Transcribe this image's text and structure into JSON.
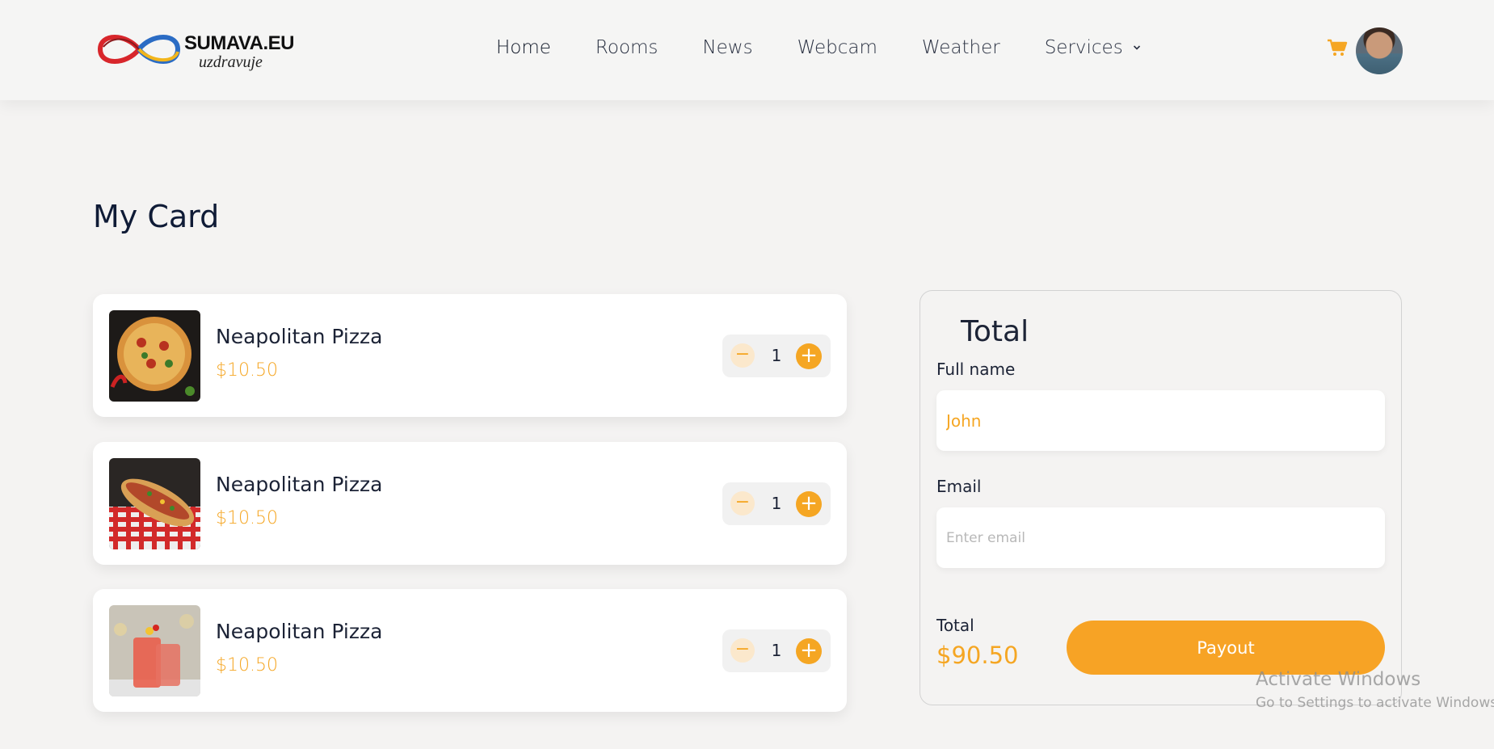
{
  "header": {
    "logo_text": "SUMAVA.EU",
    "logo_sub": "uzdravuje",
    "nav": [
      {
        "label": "Home",
        "active": true
      },
      {
        "label": "Rooms"
      },
      {
        "label": "News"
      },
      {
        "label": "Webcam"
      },
      {
        "label": "Weather"
      },
      {
        "label": "Services",
        "has_dropdown": true
      }
    ],
    "cart_icon": "cart-icon",
    "avatar_icon": "user-avatar"
  },
  "page": {
    "title": "My Card"
  },
  "items": [
    {
      "name": "Neapolitan Pizza",
      "price": "$10.50",
      "quantity": "1",
      "image": "pizza"
    },
    {
      "name": "Neapolitan Pizza",
      "price": "$10.50",
      "quantity": "1",
      "image": "hot-dog"
    },
    {
      "name": "Neapolitan Pizza",
      "price": "$10.50",
      "quantity": "1",
      "image": "cocktail-drinks"
    }
  ],
  "stepper": {
    "minus": "−",
    "plus": "+"
  },
  "summary": {
    "title": "Total",
    "full_name_label": "Full name",
    "full_name_value": "John",
    "email_label": "Email",
    "email_placeholder": "Enter email",
    "total_label": "Total",
    "total_value": "$90.50",
    "payout_label": "Payout"
  },
  "watermark": {
    "title": "Activate Windows",
    "subtitle": "Go to Settings to activate Windows."
  },
  "colors": {
    "accent": "#f5a623",
    "background": "#f4f3f2",
    "text": "#1c2336"
  }
}
